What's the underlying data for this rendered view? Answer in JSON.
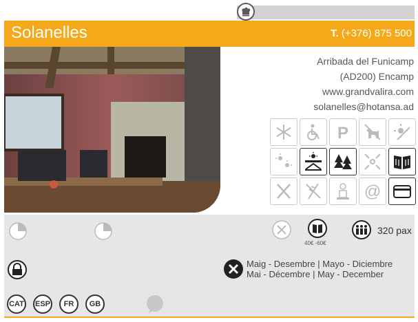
{
  "header": {
    "chef_icon": "chef-hat-icon",
    "name": "Solanelles",
    "phone_prefix": "T.",
    "phone": "(+376) 875 500"
  },
  "address": {
    "line1": "Arribada del Funicamp",
    "line2": "(AD200) Encamp",
    "website": "www.grandvalira.com",
    "email": "solanelles@hotansa.ad"
  },
  "amenities": [
    {
      "icon": "snowflake-icon",
      "active": false
    },
    {
      "icon": "wheelchair-icon",
      "active": false
    },
    {
      "icon": "parking-icon",
      "active": false
    },
    {
      "icon": "pets-icon",
      "active": false
    },
    {
      "icon": "sun-disabled-icon",
      "active": false
    },
    {
      "icon": "sun-small-icon",
      "active": false
    },
    {
      "icon": "terrace-icon",
      "active": true
    },
    {
      "icon": "trees-icon",
      "active": true
    },
    {
      "icon": "arrows-center-icon",
      "active": false
    },
    {
      "icon": "menu-book-icon",
      "active": true
    },
    {
      "icon": "cutlery-off-icon",
      "active": false
    },
    {
      "icon": "wheat-off-icon",
      "active": false
    },
    {
      "icon": "kids-chef-icon",
      "active": false
    },
    {
      "icon": "at-icon",
      "active": false
    },
    {
      "icon": "credit-card-icon",
      "active": true
    }
  ],
  "info": {
    "capacity": "320 pax",
    "price_min": "40",
    "price_max": "60",
    "season_line1": "Maig - Desembre | Mayo - Diciembre",
    "season_line2": "Mai - Décembre | May - December",
    "languages": [
      "CAT",
      "ESP",
      "FR",
      "GB"
    ]
  }
}
